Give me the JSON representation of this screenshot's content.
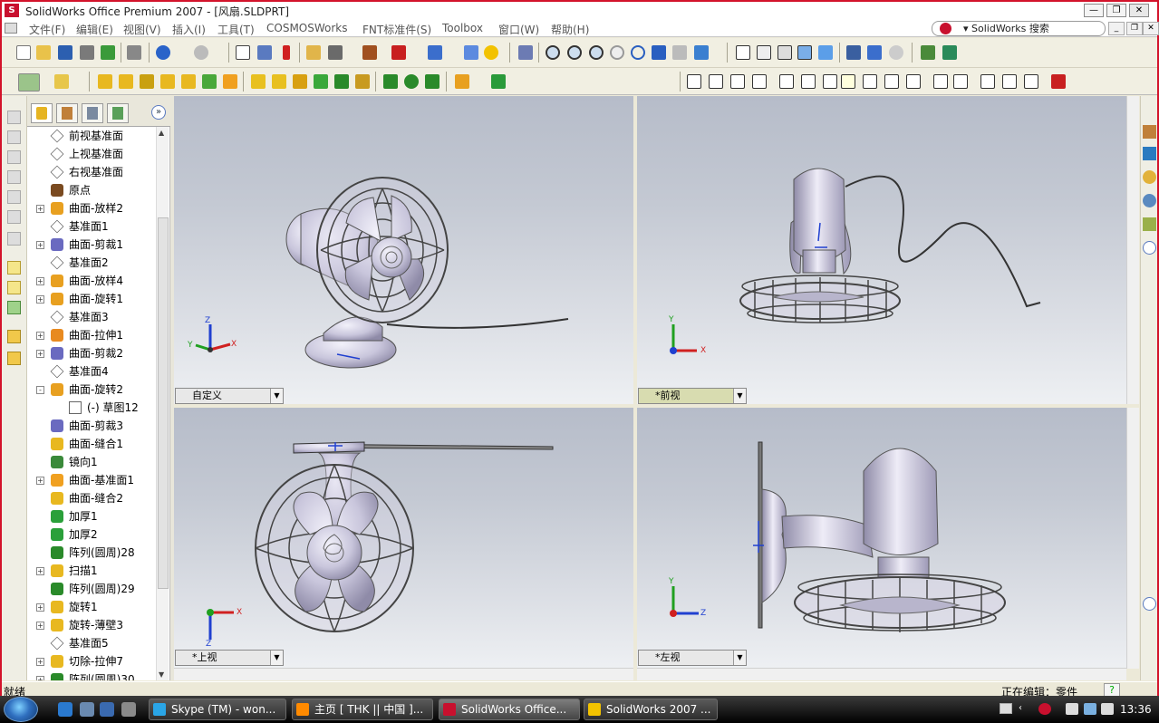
{
  "window": {
    "title": "SolidWorks Office Premium 2007 - [风扇.SLDPRT]",
    "logo_text": "S",
    "controls": [
      "—",
      "❐",
      "✕"
    ],
    "mdi_controls": [
      "_",
      "❐",
      "✕"
    ]
  },
  "menu": {
    "items": [
      "文件(F)",
      "编辑(E)",
      "视图(V)",
      "插入(I)",
      "工具(T)",
      "COSMOSWorks",
      "FNT标准件(S)",
      "Toolbox",
      "窗口(W)",
      "帮助(H)"
    ],
    "search_label": "▾ SolidWorks 搜索"
  },
  "feature_tree": {
    "items": [
      {
        "label": "前视基准面",
        "icon": "plane-icon",
        "expand": ""
      },
      {
        "label": "上视基准面",
        "icon": "plane-icon",
        "expand": ""
      },
      {
        "label": "右视基准面",
        "icon": "plane-icon",
        "expand": ""
      },
      {
        "label": "原点",
        "icon": "origin-icon",
        "expand": ""
      },
      {
        "label": "曲面-放样2",
        "icon": "loft-surface-icon",
        "expand": "+"
      },
      {
        "label": "基准面1",
        "icon": "plane-icon",
        "expand": ""
      },
      {
        "label": "曲面-剪裁1",
        "icon": "trim-surface-icon",
        "expand": "+"
      },
      {
        "label": "基准面2",
        "icon": "plane-icon",
        "expand": ""
      },
      {
        "label": "曲面-放样4",
        "icon": "loft-surface-icon",
        "expand": "+"
      },
      {
        "label": "曲面-旋转1",
        "icon": "revolve-surface-icon",
        "expand": "+"
      },
      {
        "label": "基准面3",
        "icon": "plane-icon",
        "expand": ""
      },
      {
        "label": "曲面-拉伸1",
        "icon": "extrude-surface-icon",
        "expand": "+"
      },
      {
        "label": "曲面-剪裁2",
        "icon": "trim-surface-icon",
        "expand": "+"
      },
      {
        "label": "基准面4",
        "icon": "plane-icon",
        "expand": ""
      },
      {
        "label": "曲面-旋转2",
        "icon": "revolve-surface-icon",
        "expand": "-"
      },
      {
        "label": "(-) 草图12",
        "icon": "sketch-icon",
        "expand": "",
        "indent": true
      },
      {
        "label": "曲面-剪裁3",
        "icon": "trim-surface-icon",
        "expand": ""
      },
      {
        "label": "曲面-缝合1",
        "icon": "knit-surface-icon",
        "expand": ""
      },
      {
        "label": "镜向1",
        "icon": "mirror-icon",
        "expand": ""
      },
      {
        "label": "曲面-基准面1",
        "icon": "planar-surface-icon",
        "expand": "+"
      },
      {
        "label": "曲面-缝合2",
        "icon": "knit-surface-icon",
        "expand": ""
      },
      {
        "label": "加厚1",
        "icon": "thicken-icon",
        "expand": ""
      },
      {
        "label": "加厚2",
        "icon": "thicken-icon",
        "expand": ""
      },
      {
        "label": "阵列(圆周)28",
        "icon": "circular-pattern-icon",
        "expand": ""
      },
      {
        "label": "扫描1",
        "icon": "sweep-icon",
        "expand": "+"
      },
      {
        "label": "阵列(圆周)29",
        "icon": "circular-pattern-icon",
        "expand": ""
      },
      {
        "label": "旋转1",
        "icon": "revolve-icon",
        "expand": "+"
      },
      {
        "label": "旋转-薄壁3",
        "icon": "revolve-icon",
        "expand": "+"
      },
      {
        "label": "基准面5",
        "icon": "plane-icon",
        "expand": ""
      },
      {
        "label": "切除-拉伸7",
        "icon": "cut-extrude-icon",
        "expand": "+"
      },
      {
        "label": "阵列(圆周)30",
        "icon": "circular-pattern-icon",
        "expand": "+"
      }
    ]
  },
  "viewports": {
    "top_left": {
      "label": "自定义"
    },
    "top_right": {
      "label": "*前视"
    },
    "bottom_left": {
      "label": "*上视"
    },
    "bottom_right": {
      "label": "*左视"
    }
  },
  "axes": {
    "x": "X",
    "y": "Y",
    "z": "Z"
  },
  "status": {
    "left": "就绪",
    "right": "正在编辑：零件",
    "help": "?"
  },
  "taskbar": {
    "items": [
      {
        "label": "Skype (TM) - won...",
        "icon_color": "#2aa5e6"
      },
      {
        "label": "主页 [ THK || 中国 ]...",
        "icon_color": "#ff8a00"
      },
      {
        "label": "SolidWorks Office...",
        "icon_color": "#c8102e"
      },
      {
        "label": "SolidWorks 2007 ...",
        "icon_color": "#f2c200"
      }
    ],
    "clock": "13:36"
  },
  "colors": {
    "frame": "#d3132b",
    "model": "#c9c6dc",
    "axis_x": "#d02020",
    "axis_y": "#20a020",
    "axis_z": "#2040d0"
  }
}
